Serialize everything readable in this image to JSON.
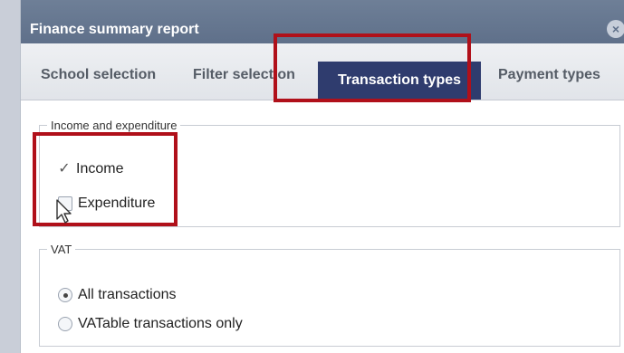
{
  "dialog": {
    "title": "Finance summary report",
    "close_icon": "close-icon"
  },
  "tabs": [
    {
      "label": "School selection",
      "active": false
    },
    {
      "label": "Filter selection",
      "active": false
    },
    {
      "label": "Transaction types",
      "active": true
    },
    {
      "label": "Payment types",
      "active": false
    }
  ],
  "income_expenditure": {
    "legend": "Income and expenditure",
    "income": {
      "label": "Income",
      "checked": true
    },
    "expenditure": {
      "label": "Expenditure",
      "checked": false
    }
  },
  "vat": {
    "legend": "VAT",
    "all": {
      "label": "All transactions",
      "selected": true
    },
    "vatable": {
      "label": "VATable transactions only",
      "selected": false
    }
  },
  "colors": {
    "titlebar": "#6e7f97",
    "active_tab": "#2f3c6e",
    "highlight": "#b0101a"
  }
}
